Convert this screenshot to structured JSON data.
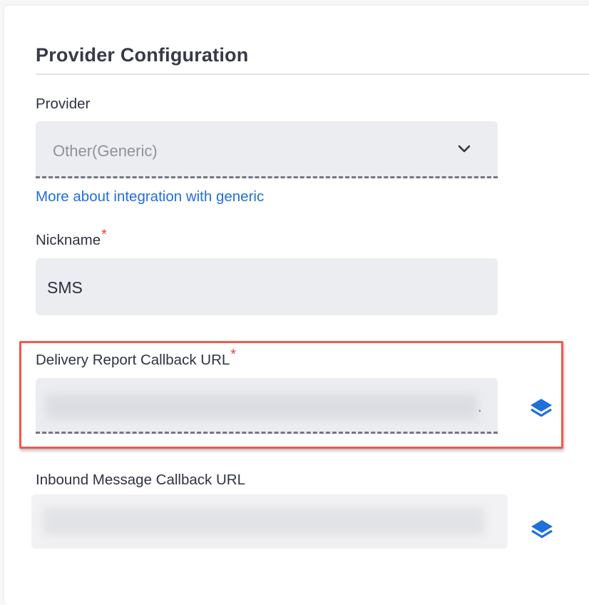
{
  "section": {
    "title": "Provider Configuration"
  },
  "provider": {
    "label": "Provider",
    "selected": "Other(Generic)",
    "icon": "chevron-down-icon",
    "help_link": "More about integration with generic"
  },
  "nickname": {
    "label": "Nickname",
    "required_mark": "*",
    "value": "SMS"
  },
  "delivery_callback": {
    "label": "Delivery Report Callback URL",
    "required_mark": "*",
    "value": "",
    "trailing_char": ".",
    "copy_icon": "layers-icon",
    "highlight_color": "#ee5a4e"
  },
  "inbound_callback": {
    "label": "Inbound Message Callback URL",
    "value": "",
    "copy_icon": "layers-icon"
  },
  "colors": {
    "link": "#1f6fdc",
    "required": "#e8463b",
    "icon": "#1f6fdc"
  }
}
